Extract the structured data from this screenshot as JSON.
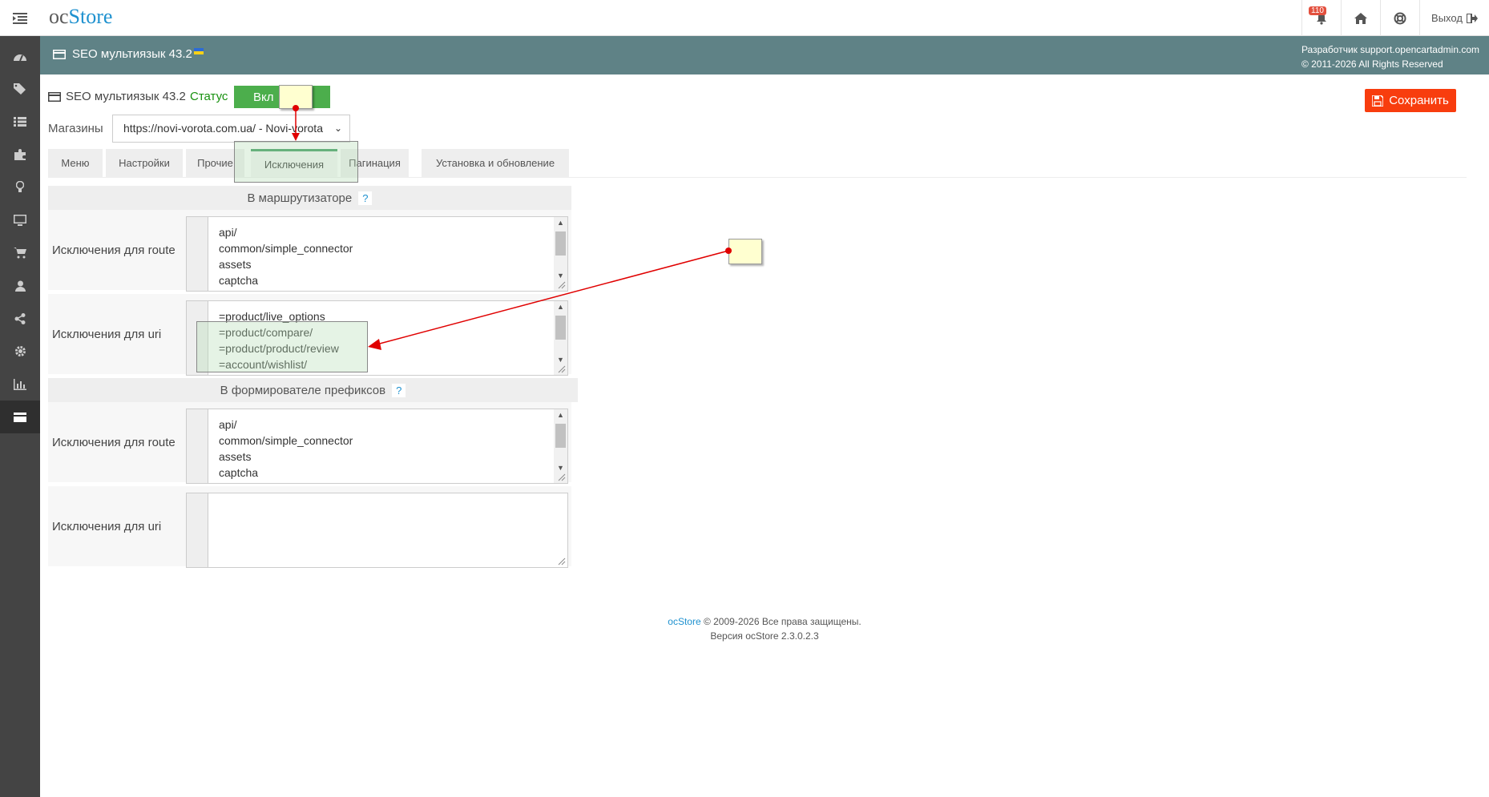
{
  "header": {
    "logo_part1": "oc",
    "logo_part2": "Store",
    "notifications_count": "110",
    "logout_label": "Выход"
  },
  "sidebar": {
    "items": [
      "dashboard-icon",
      "tags-icon",
      "list-icon",
      "puzzle-icon",
      "lightbulb-icon",
      "monitor-icon",
      "cart-icon",
      "user-icon",
      "share-icon",
      "gear-icon",
      "bar-chart-icon",
      "credit-card-icon"
    ],
    "active_index": 11
  },
  "banner": {
    "title": "SEO мультиязык 43.2",
    "dev_line1": "Разработчик support.opencartadmin.com",
    "dev_line2": "© 2011-2026 All Rights Reserved"
  },
  "module": {
    "title": "SEO мультиязык 43.2",
    "status_label": "Статус",
    "status_value": "Вкл",
    "save_label": "Сохранить"
  },
  "stores": {
    "label": "Магазины",
    "selected": "https://novi-vorota.com.ua/ - Novi-vorota"
  },
  "tabs": [
    {
      "label": "Меню"
    },
    {
      "label": "Настройки"
    },
    {
      "label": "Прочие"
    },
    {
      "label": "Исключения"
    },
    {
      "label": "Пагинация"
    },
    {
      "label": "Установка и обновление"
    }
  ],
  "active_tab": "Исключения",
  "sections": {
    "router": {
      "title": "В маршрутизаторе",
      "help": "?",
      "route_label": "Исключения для route",
      "route_lines": "api/\ncommon/simple_connector\nassets\ncaptcha",
      "uri_label": "Исключения для uri",
      "uri_lines": "=product/live_options\n=product/compare/\n=product/product/review\n=account/wishlist/"
    },
    "prefix": {
      "title": "В формирователе префиксов",
      "help": "?",
      "route_label": "Исключения для route",
      "route_lines": "api/\ncommon/simple_connector\nassets\ncaptcha",
      "uri_label": "Исключения для uri",
      "uri_lines": ""
    }
  },
  "footer": {
    "brand": "ocStore",
    "copyright": " © 2009-2026 Все права защищены.",
    "version": "Версия ocStore 2.3.0.2.3"
  },
  "colors": {
    "banner_bg": "#5f8286",
    "sidebar_bg": "#444444",
    "status_green": "#4cae4c",
    "save_red": "#f83d0e",
    "link_blue": "#1e91cf",
    "annotation_red": "#e00000"
  }
}
